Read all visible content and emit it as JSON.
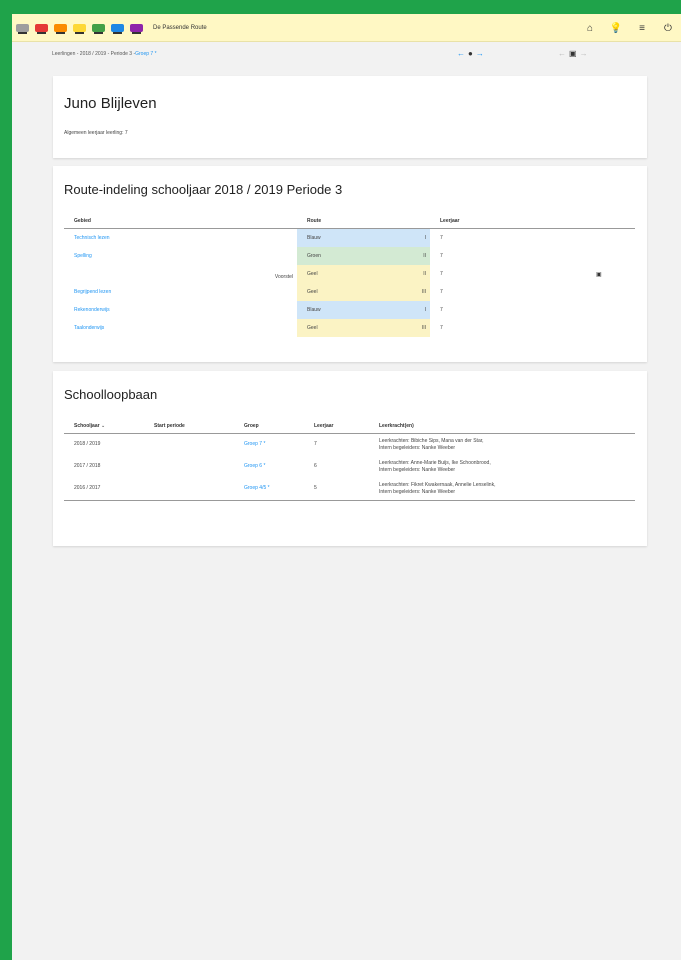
{
  "app": {
    "title": "De Passende Route",
    "bus_colors": [
      "#9e9e9e",
      "#e53935",
      "#fb8c00",
      "#fdd835",
      "#43a047",
      "#1e88e5",
      "#8e24aa"
    ]
  },
  "topbar": {
    "icons": [
      "home-icon",
      "lightbulb-icon",
      "menu-icon",
      "power-icon"
    ],
    "glyphs": [
      "⌂",
      "💡",
      "≡",
      "⏻"
    ]
  },
  "breadcrumb": {
    "prefix": "Leerlingen - 2018 / 2019 - Periode 3 - ",
    "link": "Groep 7 *"
  },
  "student": {
    "name": "Juno Blijleven",
    "grade_text": "Algemeen leerjaar leerling: 7"
  },
  "route": {
    "title": "Route-indeling schooljaar 2018 / 2019 Periode 3",
    "headers": [
      "Gebied",
      "Route",
      "Leerjaar"
    ],
    "rows": [
      {
        "area": "Technisch lezen",
        "note": "",
        "route": "Blauw",
        "level": "I",
        "year": "7",
        "cls": "r-blauw"
      },
      {
        "area": "Spelling",
        "note": "",
        "route": "Groen",
        "level": "II",
        "year": "7",
        "cls": "r-groen"
      },
      {
        "area": "",
        "note": "Voorstel",
        "route": "Geel",
        "level": "II",
        "year": "7",
        "cls": "r-geel"
      },
      {
        "area": "Begrijpend lezen",
        "note": "",
        "route": "Geel",
        "level": "III",
        "year": "7",
        "cls": "r-geel"
      },
      {
        "area": "Rekenonderwijs",
        "note": "",
        "route": "Blauw",
        "level": "I",
        "year": "7",
        "cls": "r-blauw"
      },
      {
        "area": "Taalonderwijs",
        "note": "",
        "route": "Geel",
        "level": "III",
        "year": "7",
        "cls": "r-geel"
      }
    ]
  },
  "loopbaan": {
    "title": "Schoolloopbaan",
    "headers": [
      "Schooljaar",
      "Start periode",
      "Groep",
      "Leerjaar",
      "Leerkracht(en)"
    ],
    "rows": [
      {
        "year": "2018 / 2019",
        "period": "",
        "group": "Groep 7 *",
        "grade": "7",
        "teachers": "Leerkrachten: Bibiche Sips, Mana van der Star,",
        "ib": "Intern begeleiders: Nanke Weeber"
      },
      {
        "year": "2017 / 2018",
        "period": "",
        "group": "Groep 6 *",
        "grade": "6",
        "teachers": "Leerkrachten: Anne-Marie Buijs, Ike Schoonbrood,",
        "ib": "Intern begeleiders: Nanke Weeber"
      },
      {
        "year": "2016 / 2017",
        "period": "",
        "group": "Groep 4/5 *",
        "grade": "5",
        "teachers": "Leerkrachten: Fikret Kwakernaak, Annelie Lenselink,",
        "ib": "Intern begeleiders: Nanke Weeber"
      }
    ]
  }
}
